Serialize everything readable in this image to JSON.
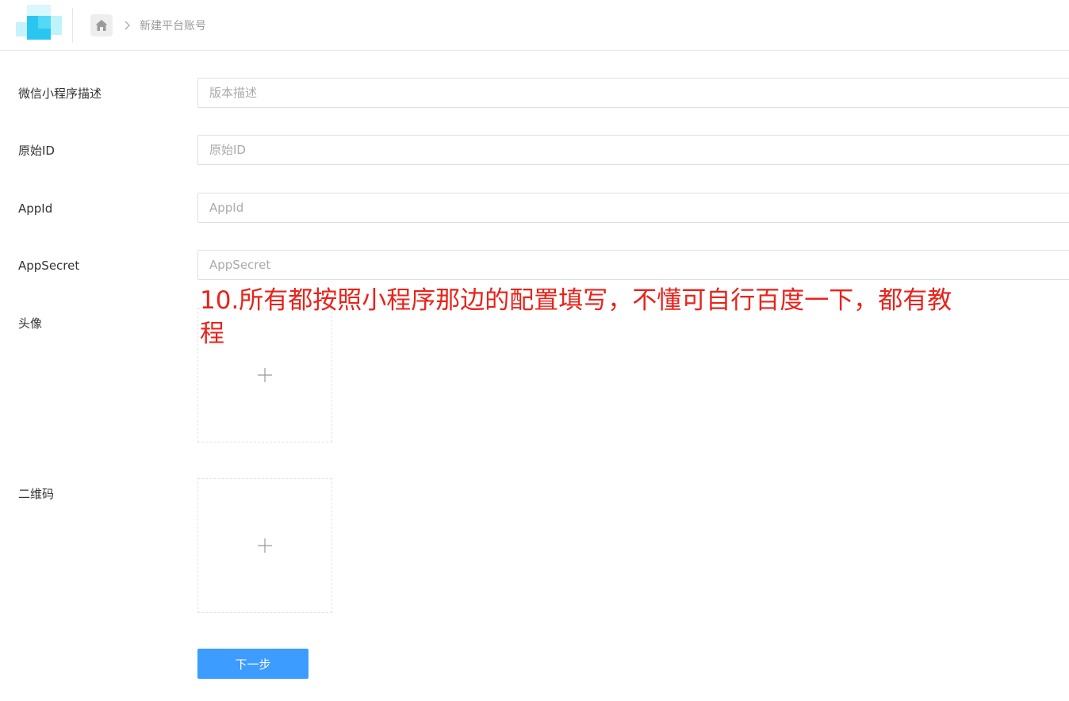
{
  "header": {
    "logo_colors": [
      "#b8f0fb",
      "#6fe0f5",
      "#2bc6f0",
      "#8fd8ff"
    ],
    "home_icon": "home-icon",
    "separator_icon": "chevron-right-icon",
    "breadcrumb_current": "新建平台账号"
  },
  "form": {
    "fields": [
      {
        "label": "微信小程序描述",
        "placeholder": "版本描述",
        "value": ""
      },
      {
        "label": "原始ID",
        "placeholder": "原始ID",
        "value": ""
      },
      {
        "label": "AppId",
        "placeholder": "AppId",
        "value": ""
      },
      {
        "label": "AppSecret",
        "placeholder": "AppSecret",
        "value": ""
      }
    ],
    "uploads": [
      {
        "label": "头像",
        "icon": "plus-icon"
      },
      {
        "label": "二维码",
        "icon": "plus-icon"
      }
    ],
    "next_button": "下一步"
  },
  "annotation": {
    "text": "10.所有都按照小程序那边的配置填写，不懂可自行百度一下，都有教程",
    "color": "#e8231b"
  },
  "colors": {
    "primary": "#3c9cff",
    "border": "#dcdfe6"
  }
}
